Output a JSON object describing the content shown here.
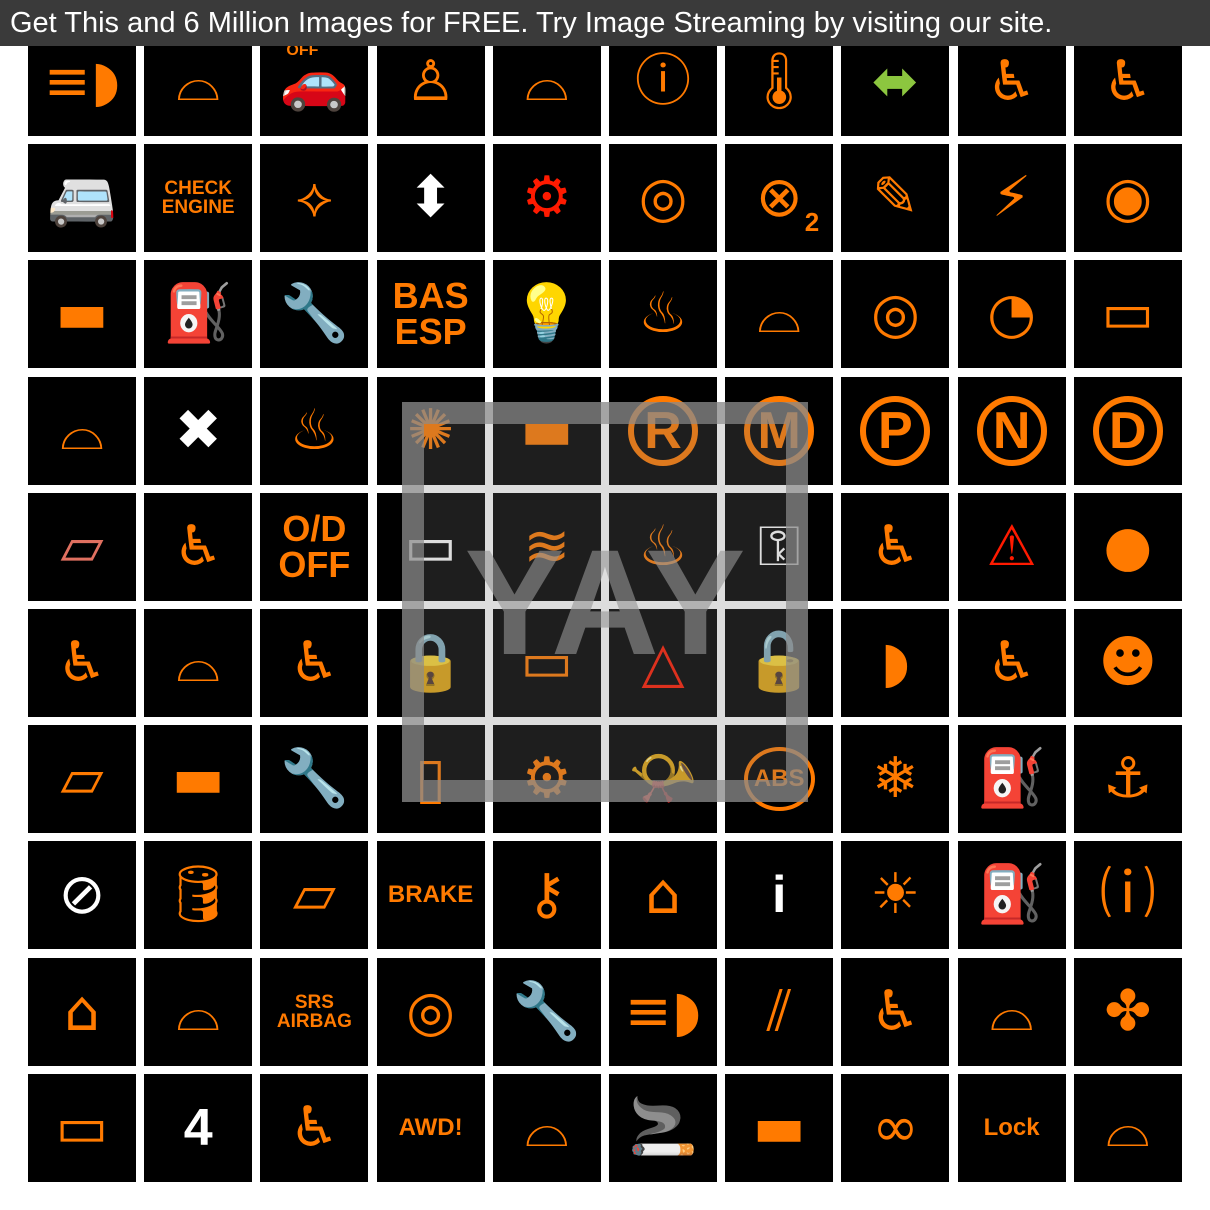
{
  "banner": "Get This and 6 Million Images for FREE. Try Image Streaming by visiting our site.",
  "watermark": "YAY",
  "colors": {
    "orange": "#ff7a00",
    "red": "#ff1a00",
    "white": "#ffffff",
    "green": "#8cc63f",
    "pink": "#e07060",
    "background": "#000000"
  },
  "icons": [
    {
      "icon": "low-beam-headlight"
    },
    {
      "icon": "windshield-wiper"
    },
    {
      "icon": "engine-off-car",
      "text": "OFF"
    },
    {
      "icon": "seatbelt"
    },
    {
      "icon": "washer-fluid"
    },
    {
      "icon": "brake-warning"
    },
    {
      "icon": "coolant-temperature"
    },
    {
      "icon": "turn-signals",
      "color": "green"
    },
    {
      "icon": "seat-airflow"
    },
    {
      "icon": "seat-vibration"
    },
    {
      "icon": "car-cargo"
    },
    {
      "icon": "check-engine-text",
      "text": "CHECK ENGINE"
    },
    {
      "icon": "side-lights"
    },
    {
      "icon": "window-lift",
      "color": "white"
    },
    {
      "icon": "gear-warning",
      "color": "red"
    },
    {
      "icon": "steering-wheel"
    },
    {
      "icon": "passenger-airbag-off",
      "text": "2"
    },
    {
      "icon": "seat-adjust"
    },
    {
      "icon": "fuse-box"
    },
    {
      "icon": "steering-wheel-buttons"
    },
    {
      "icon": "convertible"
    },
    {
      "icon": "fuel-door"
    },
    {
      "icon": "wrench"
    },
    {
      "icon": "bas-esp",
      "text": "BAS ESP"
    },
    {
      "icon": "interior-light"
    },
    {
      "icon": "heated-seat"
    },
    {
      "icon": "rear-wiper"
    },
    {
      "icon": "brake-pad"
    },
    {
      "icon": "cruise-control"
    },
    {
      "icon": "battery"
    },
    {
      "icon": "washer"
    },
    {
      "icon": "window-lock",
      "color": "white"
    },
    {
      "icon": "rear-defrost"
    },
    {
      "icon": "dome-light"
    },
    {
      "icon": "car-trunk"
    },
    {
      "icon": "gear-r",
      "text": "R"
    },
    {
      "icon": "gear-m",
      "text": "M"
    },
    {
      "icon": "gear-p",
      "text": "P"
    },
    {
      "icon": "gear-n",
      "text": "N"
    },
    {
      "icon": "gear-d",
      "text": "D"
    },
    {
      "icon": "window-wiper",
      "color": "pink"
    },
    {
      "icon": "airbag-passenger"
    },
    {
      "icon": "overdrive-off",
      "text": "O/D OFF"
    },
    {
      "icon": "door-open",
      "color": "white"
    },
    {
      "icon": "traction-control"
    },
    {
      "icon": "rear-defrost-2"
    },
    {
      "icon": "door-key",
      "color": "white"
    },
    {
      "icon": "seat-recline"
    },
    {
      "icon": "hazard-triangle",
      "color": "red"
    },
    {
      "icon": "seatbelt-airbag"
    },
    {
      "icon": "airflow-person"
    },
    {
      "icon": "windshield-heat"
    },
    {
      "icon": "child-seat"
    },
    {
      "icon": "car-lock"
    },
    {
      "icon": "coolant-level"
    },
    {
      "icon": "hazard-lights",
      "color": "red"
    },
    {
      "icon": "door-locks"
    },
    {
      "icon": "fog-light"
    },
    {
      "icon": "airflow-feet"
    },
    {
      "icon": "airbag"
    },
    {
      "icon": "rear-washer"
    },
    {
      "icon": "car-hood"
    },
    {
      "icon": "wrench-service"
    },
    {
      "icon": "doors-open"
    },
    {
      "icon": "check-engine"
    },
    {
      "icon": "horn"
    },
    {
      "icon": "abs",
      "text": "ABS"
    },
    {
      "icon": "frost"
    },
    {
      "icon": "fuel-pump"
    },
    {
      "icon": "isofix"
    },
    {
      "icon": "no-child-seat",
      "color": "white"
    },
    {
      "icon": "oil-pressure"
    },
    {
      "icon": "rear-window-wiper"
    },
    {
      "icon": "brake-text",
      "text": "BRAKE"
    },
    {
      "icon": "key"
    },
    {
      "icon": "car-hatch"
    },
    {
      "icon": "manual-info",
      "color": "white",
      "text": "i"
    },
    {
      "icon": "bulb-failure"
    },
    {
      "icon": "no-fuel"
    },
    {
      "icon": "tire-pressure"
    },
    {
      "icon": "hatchback"
    },
    {
      "icon": "washer-fluid-level"
    },
    {
      "icon": "srs-airbag",
      "text": "SRS AIRBAG"
    },
    {
      "icon": "brake-circle"
    },
    {
      "icon": "service-clock"
    },
    {
      "icon": "high-beam"
    },
    {
      "icon": "lane-assist"
    },
    {
      "icon": "child-seat-2"
    },
    {
      "icon": "windshield-defrost"
    },
    {
      "icon": "fan"
    },
    {
      "icon": "battery-2"
    },
    {
      "icon": "window-4",
      "color": "white",
      "text": "4"
    },
    {
      "icon": "airflow-person-2"
    },
    {
      "icon": "awd-warning",
      "text": "AWD!"
    },
    {
      "icon": "wiper"
    },
    {
      "icon": "smoking"
    },
    {
      "icon": "sedan"
    },
    {
      "icon": "glow-plug"
    },
    {
      "icon": "steering-lock",
      "text": "Lock"
    },
    {
      "icon": "wiper-2"
    }
  ]
}
